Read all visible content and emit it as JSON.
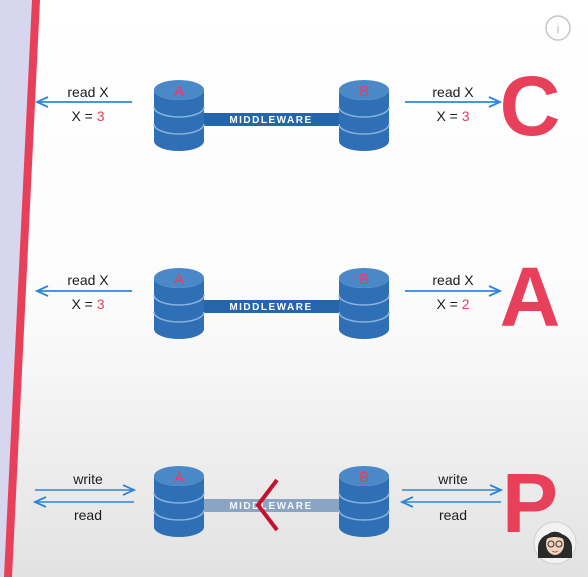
{
  "info_icon_label": "i",
  "colors": {
    "db_body": "#2f6fb6",
    "db_top": "#4a88c8",
    "middleware_bar": "#2565ac",
    "middleware_bar_broken": "#8aa4c4",
    "arrow": "#2e86d9",
    "highlight": "#e8405a",
    "break_mark": "#c8102e",
    "left_edge": "#e8405a",
    "sidebar": "#d6d6ee"
  },
  "rows": [
    {
      "letter": "C",
      "db_left": "A",
      "db_right": "B",
      "middleware": "MIDDLEWARE",
      "left": {
        "top": "read X",
        "bottom_prefix": "X = ",
        "bottom_value": "3"
      },
      "right": {
        "top": "read X",
        "bottom_prefix": "X = ",
        "bottom_value": "3"
      }
    },
    {
      "letter": "A",
      "db_left": "A",
      "db_right": "B",
      "middleware": "MIDDLEWARE",
      "left": {
        "top": "read X",
        "bottom_prefix": "X = ",
        "bottom_value": "3"
      },
      "right": {
        "top": "read X",
        "bottom_prefix": "X = ",
        "bottom_value": "2"
      }
    },
    {
      "letter": "P",
      "db_left": "A",
      "db_right": "B",
      "middleware": "MIDDLEWARE",
      "partitioned": true,
      "left": {
        "top": "write",
        "bottom": "read"
      },
      "right": {
        "top": "write",
        "bottom": "read"
      }
    }
  ],
  "avatar": {
    "icon": "person-avatar-icon"
  }
}
